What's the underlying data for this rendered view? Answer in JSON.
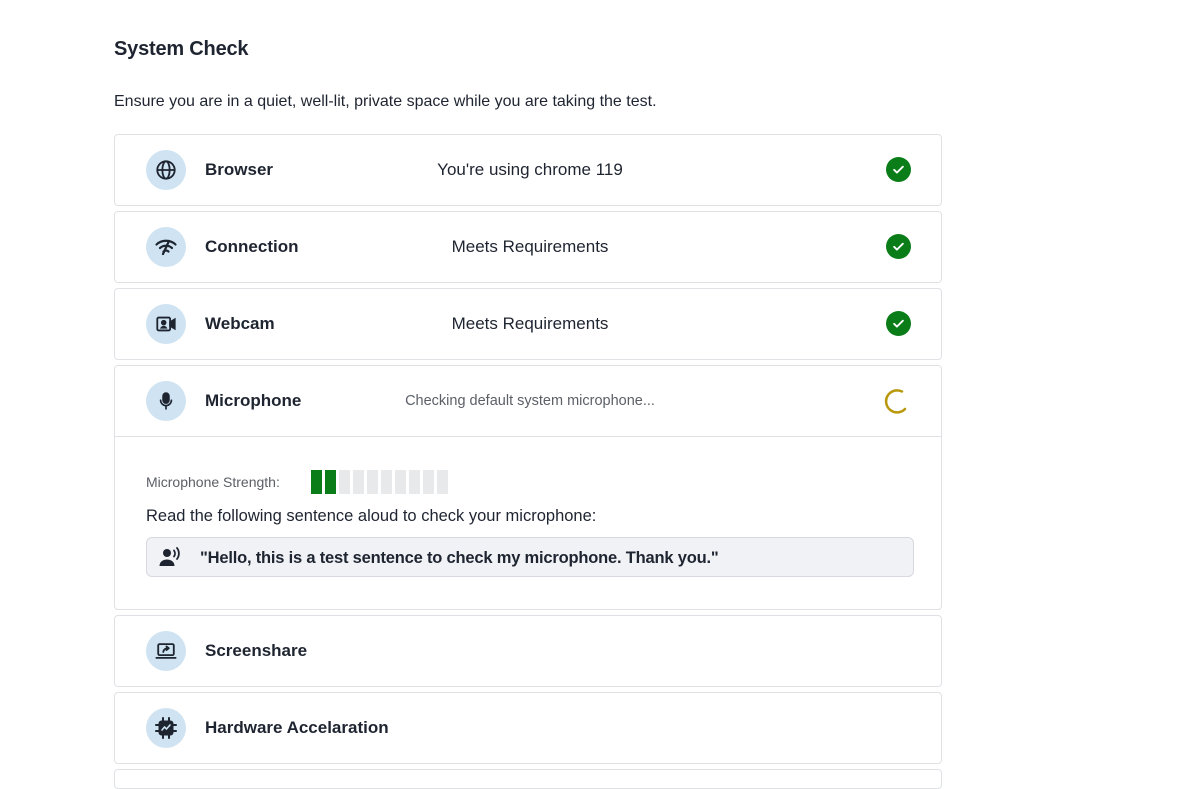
{
  "page": {
    "title": "System Check",
    "subtitle": "Ensure you are in a quiet, well-lit, private space while you are taking the test."
  },
  "checks": [
    {
      "label": "Browser",
      "status": "You're using chrome 119",
      "state": "passed",
      "icon": "globe-icon"
    },
    {
      "label": "Connection",
      "status": "Meets Requirements",
      "state": "passed",
      "icon": "wifi-icon"
    },
    {
      "label": "Webcam",
      "status": "Meets Requirements",
      "state": "passed",
      "icon": "webcam-icon"
    },
    {
      "label": "Microphone",
      "status": "Checking default system microphone...",
      "state": "checking",
      "icon": "microphone-icon"
    },
    {
      "label": "Screenshare",
      "status": "",
      "state": "pending",
      "icon": "screenshare-icon"
    },
    {
      "label": "Hardware Accelaration",
      "status": "",
      "state": "pending",
      "icon": "chip-icon"
    }
  ],
  "microphone": {
    "strength_label": "Microphone Strength:",
    "strength_level": 2,
    "strength_max": 10,
    "instruction": "Read the following sentence aloud to check your microphone:",
    "sentence": "\"Hello, this is a test sentence to check my microphone. Thank you.\""
  },
  "colors": {
    "success": "#0a7d19",
    "spinner": "#b8980a",
    "icon_bg": "#cfe3f2"
  }
}
